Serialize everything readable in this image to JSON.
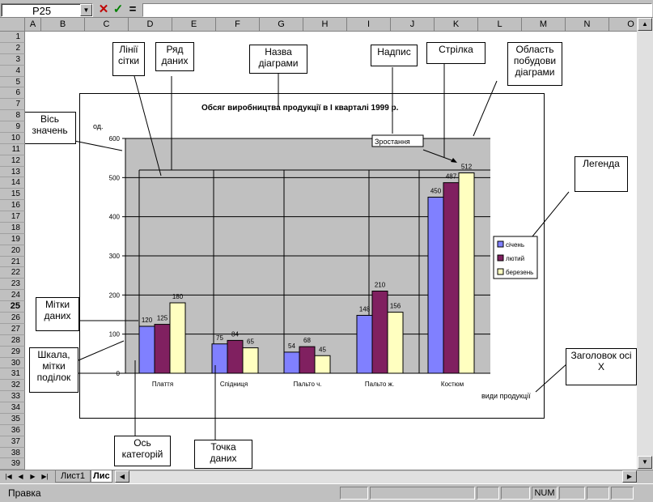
{
  "formula_bar": {
    "name_box": "P25",
    "cancel_icon": "✕",
    "enter_icon": "✓",
    "equals_icon": "=",
    "formula": ""
  },
  "columns": [
    "A",
    "B",
    "C",
    "D",
    "E",
    "F",
    "G",
    "H",
    "I",
    "J",
    "K",
    "L",
    "M",
    "N",
    "O"
  ],
  "rows": [
    "1",
    "2",
    "3",
    "4",
    "5",
    "6",
    "7",
    "8",
    "9",
    "10",
    "11",
    "12",
    "13",
    "14",
    "15",
    "16",
    "17",
    "18",
    "19",
    "20",
    "21",
    "22",
    "23",
    "24",
    "25",
    "26",
    "27",
    "28",
    "29",
    "30",
    "31",
    "32",
    "33",
    "34",
    "35",
    "36",
    "37",
    "38",
    "39"
  ],
  "active_row": "25",
  "sheet_tabs": [
    "Лист1",
    "Лис"
  ],
  "status": {
    "text": "Правка",
    "num": "NUM"
  },
  "callouts": {
    "gridlines": "Лінії сітки",
    "data_series": "Ряд даних",
    "chart_title": "Назва діаграми",
    "text_box": "Надпис",
    "arrow": "Стрілка",
    "plot_area": "Область побудови діаграми",
    "value_axis": "Вісь значень",
    "legend": "Легенда",
    "data_labels": "Мітки даних",
    "scale": "Шкала, мітки поділок",
    "x_axis_title": "Заголовок осі X",
    "category_axis": "Ось категорій",
    "data_point": "Точка даних"
  },
  "chart_data": {
    "type": "bar",
    "title": "Обсяг виробництва продукції в I кварталі 1999 р.",
    "ylabel": "од.",
    "xlabel": "види продукції",
    "annotation": "Зростання",
    "categories": [
      "Плаття",
      "Спідниця",
      "Пальто ч.",
      "Пальто ж.",
      "Костюм"
    ],
    "yticks": [
      "0",
      "100",
      "200",
      "300",
      "400",
      "500",
      "600"
    ],
    "ylim": [
      0,
      600
    ],
    "series": [
      {
        "name": "січень",
        "values": [
          120,
          75,
          54,
          148,
          450
        ],
        "color": "#8080ff"
      },
      {
        "name": "лютий",
        "values": [
          125,
          84,
          68,
          210,
          487
        ],
        "color": "#802060"
      },
      {
        "name": "березень",
        "values": [
          180,
          65,
          45,
          156,
          512
        ],
        "color": "#ffffc0"
      }
    ],
    "data_labels": [
      [
        "120",
        "75",
        "54",
        "148",
        "450"
      ],
      [
        "125",
        "84",
        "68",
        "210",
        "487"
      ],
      [
        "180",
        "65",
        "45",
        "156",
        "512"
      ]
    ],
    "grid": true,
    "legend_position": "right"
  }
}
